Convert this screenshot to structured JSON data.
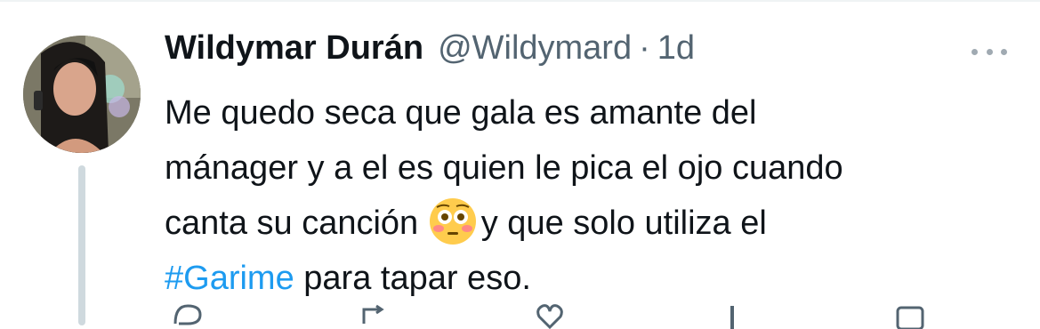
{
  "tweet": {
    "author": {
      "display_name": "Wildymar Durán",
      "handle": "@Wildymard"
    },
    "separator": "·",
    "time": "1d",
    "text_lines": {
      "line1": "Me quedo seca que gala es amante del",
      "line2": "mánager y a el es quien le pica el ojo cuando",
      "line3_before": "canta su canción ",
      "line3_after": "y que solo utiliza el",
      "line4_hashtag": "#Garime",
      "line4_after": " para tapar eso."
    },
    "emoji": "flushed-face",
    "icons": {
      "more": "ellipsis-icon",
      "reply": "reply-icon",
      "retweet": "retweet-icon",
      "like": "like-icon",
      "views": "views-icon",
      "share": "share-icon"
    },
    "colors": {
      "text": "#0f1419",
      "secondary": "#536471",
      "link": "#1d9bf0",
      "thread_line": "#cfd9de"
    }
  }
}
